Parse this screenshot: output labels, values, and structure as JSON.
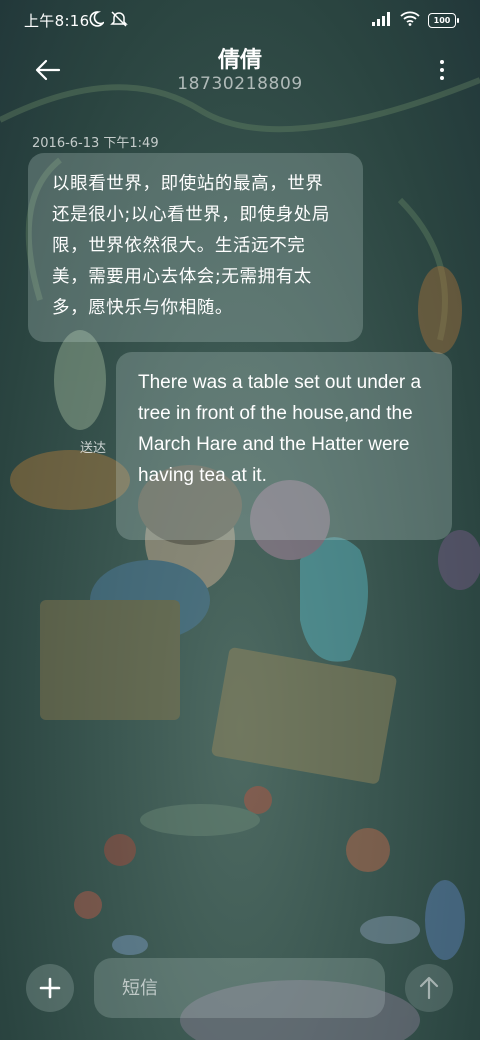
{
  "status_bar": {
    "time": "上午8:16",
    "battery": "100",
    "icons": [
      "moon-icon",
      "mute-icon",
      "signal-icon",
      "wifi-icon",
      "battery-icon"
    ]
  },
  "header": {
    "contact_name": "倩倩",
    "contact_number": "18730218809",
    "back_icon": "back-arrow-icon",
    "more_icon": "more-vertical-icon"
  },
  "conversation": {
    "timestamp": "2016-6-13 下午1:49",
    "incoming_message": "以眼看世界，即使站的最高，世界还是很小;以心看世界，即使身处局限，世界依然很大。生活远不完美，需要用心去体会;无需拥有太多，愿快乐与你相随。",
    "outgoing_message": "There was a table set out under a tree in front of the house,and the March Hare and the Hatter were having tea at it.",
    "outgoing_status": "送达"
  },
  "composer": {
    "placeholder": "短信",
    "add_icon": "plus-icon",
    "send_icon": "send-arrow-icon"
  },
  "colors": {
    "background": "#2f4a46",
    "bubble": "rgba(196,215,214,0.26)",
    "text": "#ffffff"
  }
}
